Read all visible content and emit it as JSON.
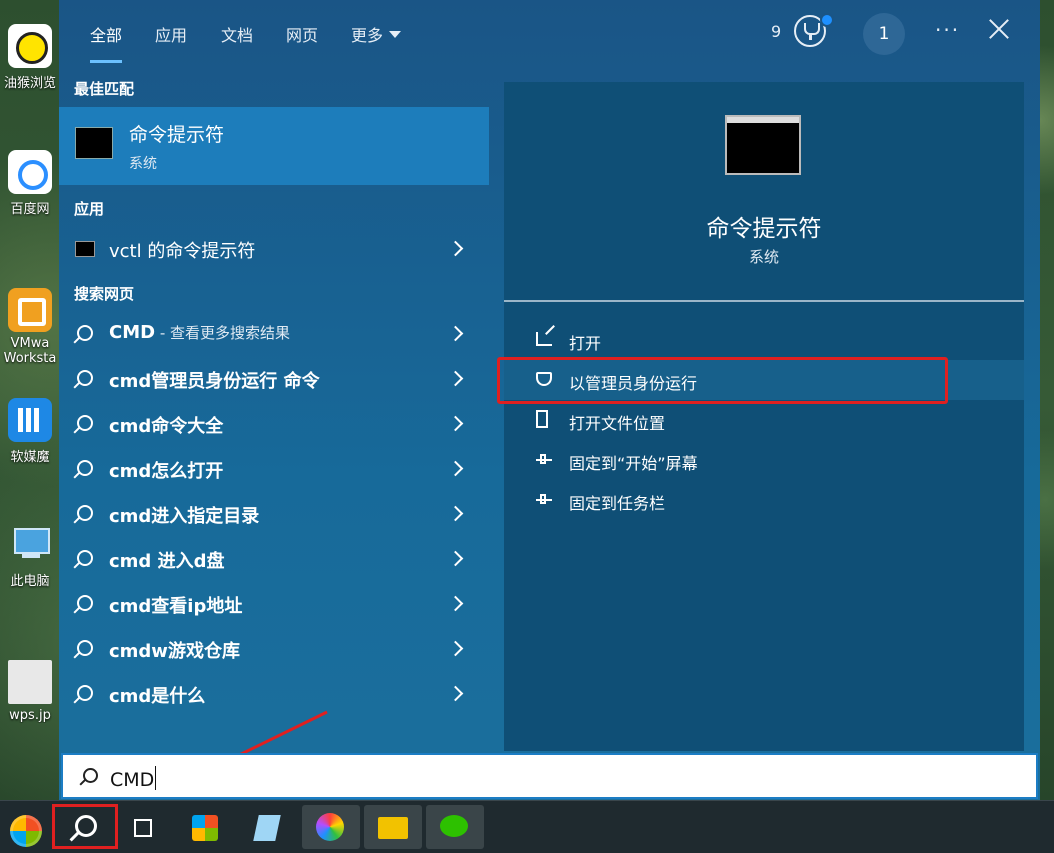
{
  "desktop_icons": [
    {
      "label": "油猴浏览",
      "color": "#ffe400"
    },
    {
      "label": "百度网",
      "color": "#2b8fff"
    },
    {
      "label": "VMwa",
      "label2": "Worksta",
      "color": "#f0a020"
    },
    {
      "label": "软媒魔",
      "color": "#1e88e5"
    },
    {
      "label": "此电脑",
      "color": "#4aa3df"
    },
    {
      "label": "wps.jp",
      "color": "#e8e8e8"
    }
  ],
  "tabs": [
    {
      "label": "全部"
    },
    {
      "label": "应用"
    },
    {
      "label": "文档"
    },
    {
      "label": "网页"
    },
    {
      "label": "更多"
    }
  ],
  "header": {
    "points": "9",
    "account_badge": "1",
    "more": "···"
  },
  "left": {
    "best_match_title": "最佳匹配",
    "best_match": {
      "name": "命令提示符",
      "type": "系统"
    },
    "apps_title": "应用",
    "app_item": "vctl 的命令提示符",
    "web_title": "搜索网页",
    "web_first": {
      "bold": "CMD",
      "hint": " - 查看更多搜索结果"
    },
    "web_items": [
      "cmd管理员身份运行 命令",
      "cmd命令大全",
      "cmd怎么打开",
      "cmd进入指定目录",
      "cmd 进入d盘",
      "cmd查看ip地址",
      "cmdw游戏仓库",
      "cmd是什么"
    ]
  },
  "right": {
    "title": "命令提示符",
    "subtitle": "系统",
    "actions": [
      {
        "label": "打开",
        "icon": "open-icon"
      },
      {
        "label": "以管理员身份运行",
        "icon": "shield-icon"
      },
      {
        "label": "打开文件位置",
        "icon": "folder-icon"
      },
      {
        "label": "固定到“开始”屏幕",
        "icon": "pin-icon"
      },
      {
        "label": "固定到任务栏",
        "icon": "pin-icon"
      }
    ]
  },
  "search": {
    "value": "CMD"
  },
  "colors": {
    "accent": "#1d7dbb",
    "highlight_box": "#e02020",
    "panel": "#1a5586"
  }
}
